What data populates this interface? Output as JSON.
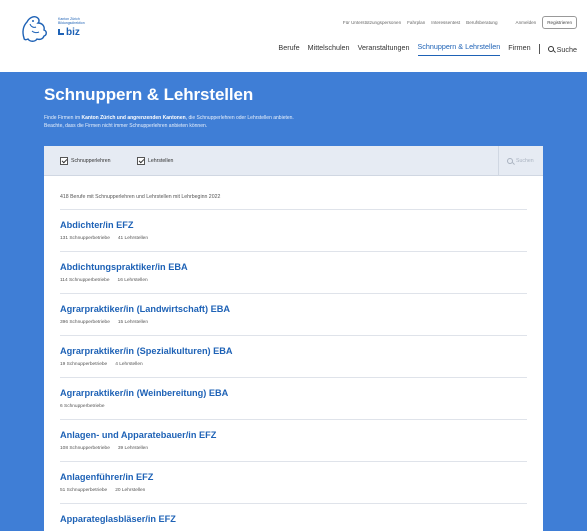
{
  "header": {
    "logo": {
      "small_text": "Kanton Zürich Bildungsdirektion",
      "brand": "biz"
    },
    "top_links": [
      "Für Unterstützungspersonen",
      "Fahrplan",
      "Interessentest",
      "Berufsberatung"
    ],
    "login": "Anmelden",
    "register": "Registrieren",
    "nav": [
      {
        "label": "Berufe",
        "active": false
      },
      {
        "label": "Mittelschulen",
        "active": false
      },
      {
        "label": "Veranstaltungen",
        "active": false
      },
      {
        "label": "Schnuppern & Lehrstellen",
        "active": true
      },
      {
        "label": "Firmen",
        "active": false
      }
    ],
    "search": "Suche"
  },
  "hero": {
    "title": "Schnuppern & Lehrstellen",
    "desc_1a": "Finde Firmen im ",
    "desc_1b": "Kanton Zürich und angrenzenden Kantonen",
    "desc_1c": ", die Schnupperlehren oder Lehrstellen anbieten.",
    "desc_2": "Beachte, dass die Firmen nicht immer Schnupperlehren anbieten können."
  },
  "filters": {
    "schnupper": "Schnupperlehren",
    "lehrstellen": "Lehrstellen",
    "search_placeholder": "Suchen"
  },
  "results_count": "418 Berufe mit Schnupperlehren und Lehrstellen mit Lehrbeginn 2022",
  "results": [
    {
      "title": "Abdichter/in EFZ",
      "schnupper": "131 Schnupperbetriebe",
      "lehr": "41 Lehrstellen"
    },
    {
      "title": "Abdichtungspraktiker/in EBA",
      "schnupper": "114 Schnupperbetriebe",
      "lehr": "16 Lehrstellen"
    },
    {
      "title": "Agrarpraktiker/in (Landwirtschaft) EBA",
      "schnupper": "396 Schnupperbetriebe",
      "lehr": "15 Lehrstellen"
    },
    {
      "title": "Agrarpraktiker/in (Spezialkulturen) EBA",
      "schnupper": "19 Schnupperbetriebe",
      "lehr": "4 Lehrstellen"
    },
    {
      "title": "Agrarpraktiker/in (Weinbereitung) EBA",
      "schnupper": "6 Schnupperbetriebe",
      "lehr": ""
    },
    {
      "title": "Anlagen- und Apparatebauer/in EFZ",
      "schnupper": "108 Schnupperbetriebe",
      "lehr": "39 Lehrstellen"
    },
    {
      "title": "Anlagenführer/in EFZ",
      "schnupper": "51 Schnupperbetriebe",
      "lehr": "20 Lehrstellen"
    },
    {
      "title": "Apparateglasbläser/in EFZ",
      "schnupper": "",
      "lehr": ""
    }
  ],
  "colors": {
    "brand_blue": "#1e62b6",
    "hero_blue": "#3f7ed6",
    "filter_bg": "#e6ebf3"
  }
}
